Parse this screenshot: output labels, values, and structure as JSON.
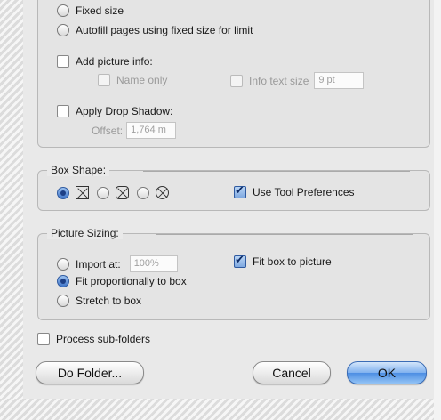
{
  "picture_options": {
    "fixed_size": "Fixed size",
    "autofill": "Autofill pages using fixed size for limit",
    "add_picture_info": "Add picture info:",
    "name_only": "Name only",
    "info_text_size": "Info text size",
    "info_text_size_value": "9 pt",
    "apply_drop_shadow": "Apply Drop Shadow:",
    "offset_label": "Offset:",
    "offset_value": "1,764 m"
  },
  "box_shape": {
    "title": "Box Shape:",
    "use_tool_prefs": "Use Tool Preferences"
  },
  "picture_sizing": {
    "title": "Picture Sizing:",
    "import_at": "Import at:",
    "import_value": "100%",
    "fit_box": "Fit box to picture",
    "fit_proportionally": "Fit proportionally to box",
    "stretch": "Stretch to box"
  },
  "process_subfolders": "Process sub-folders",
  "buttons": {
    "do_folder": "Do Folder...",
    "cancel": "Cancel",
    "ok": "OK"
  },
  "accent": "#4d8ee3"
}
